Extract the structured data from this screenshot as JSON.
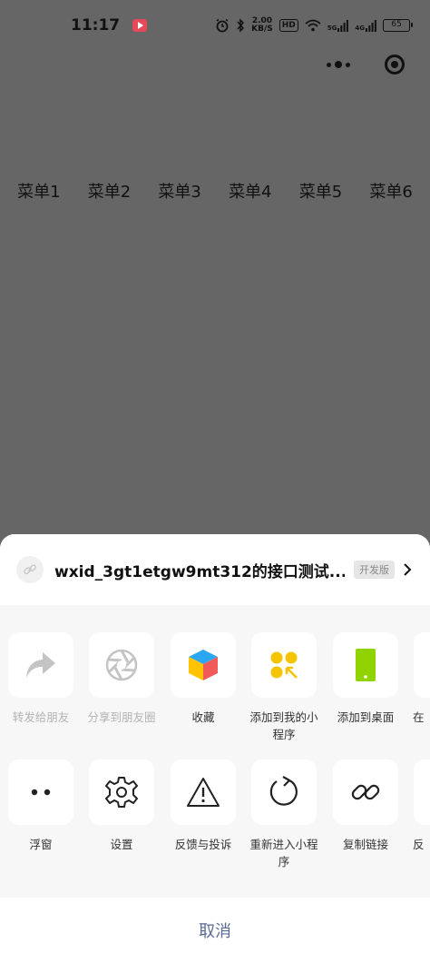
{
  "status": {
    "time": "11:17",
    "net_speed_value": "2.00",
    "net_speed_unit": "KB/S",
    "hd_label": "HD",
    "sim1_label": "5G",
    "sim2_label": "4G",
    "battery": "65"
  },
  "menu": {
    "items": [
      "菜单1",
      "菜单2",
      "菜单3",
      "菜单4",
      "菜单5",
      "菜单6"
    ]
  },
  "sheet": {
    "title": "wxid_3gt1etgw9mt312的接口测试...",
    "badge": "开发版",
    "row1": [
      {
        "label": "转发给朋友",
        "icon": "share-arrow-icon",
        "disabled": true
      },
      {
        "label": "分享到朋友圈",
        "icon": "aperture-icon",
        "disabled": true
      },
      {
        "label": "收藏",
        "icon": "cube-icon",
        "disabled": false
      },
      {
        "label": "添加到我的小程序",
        "icon": "mini-program-icon",
        "disabled": false
      },
      {
        "label": "添加到桌面",
        "icon": "phone-icon",
        "disabled": false
      },
      {
        "label": "在",
        "icon": "partial-icon",
        "disabled": false
      }
    ],
    "row2": [
      {
        "label": "浮窗",
        "icon": "float-window-icon"
      },
      {
        "label": "设置",
        "icon": "gear-icon"
      },
      {
        "label": "反馈与投诉",
        "icon": "warning-icon"
      },
      {
        "label": "重新进入小程序",
        "icon": "reload-icon"
      },
      {
        "label": "复制链接",
        "icon": "link-icon"
      },
      {
        "label": "反",
        "icon": "partial-icon"
      }
    ],
    "cancel_label": "取消"
  },
  "colors": {
    "backdrop": "#666666",
    "sheet_bg": "#f7f7f7",
    "cancel_text": "#576b95",
    "disabled_text": "#b3b3b3",
    "cube_yellow": "#ffc300",
    "phone_green": "#91d300"
  }
}
